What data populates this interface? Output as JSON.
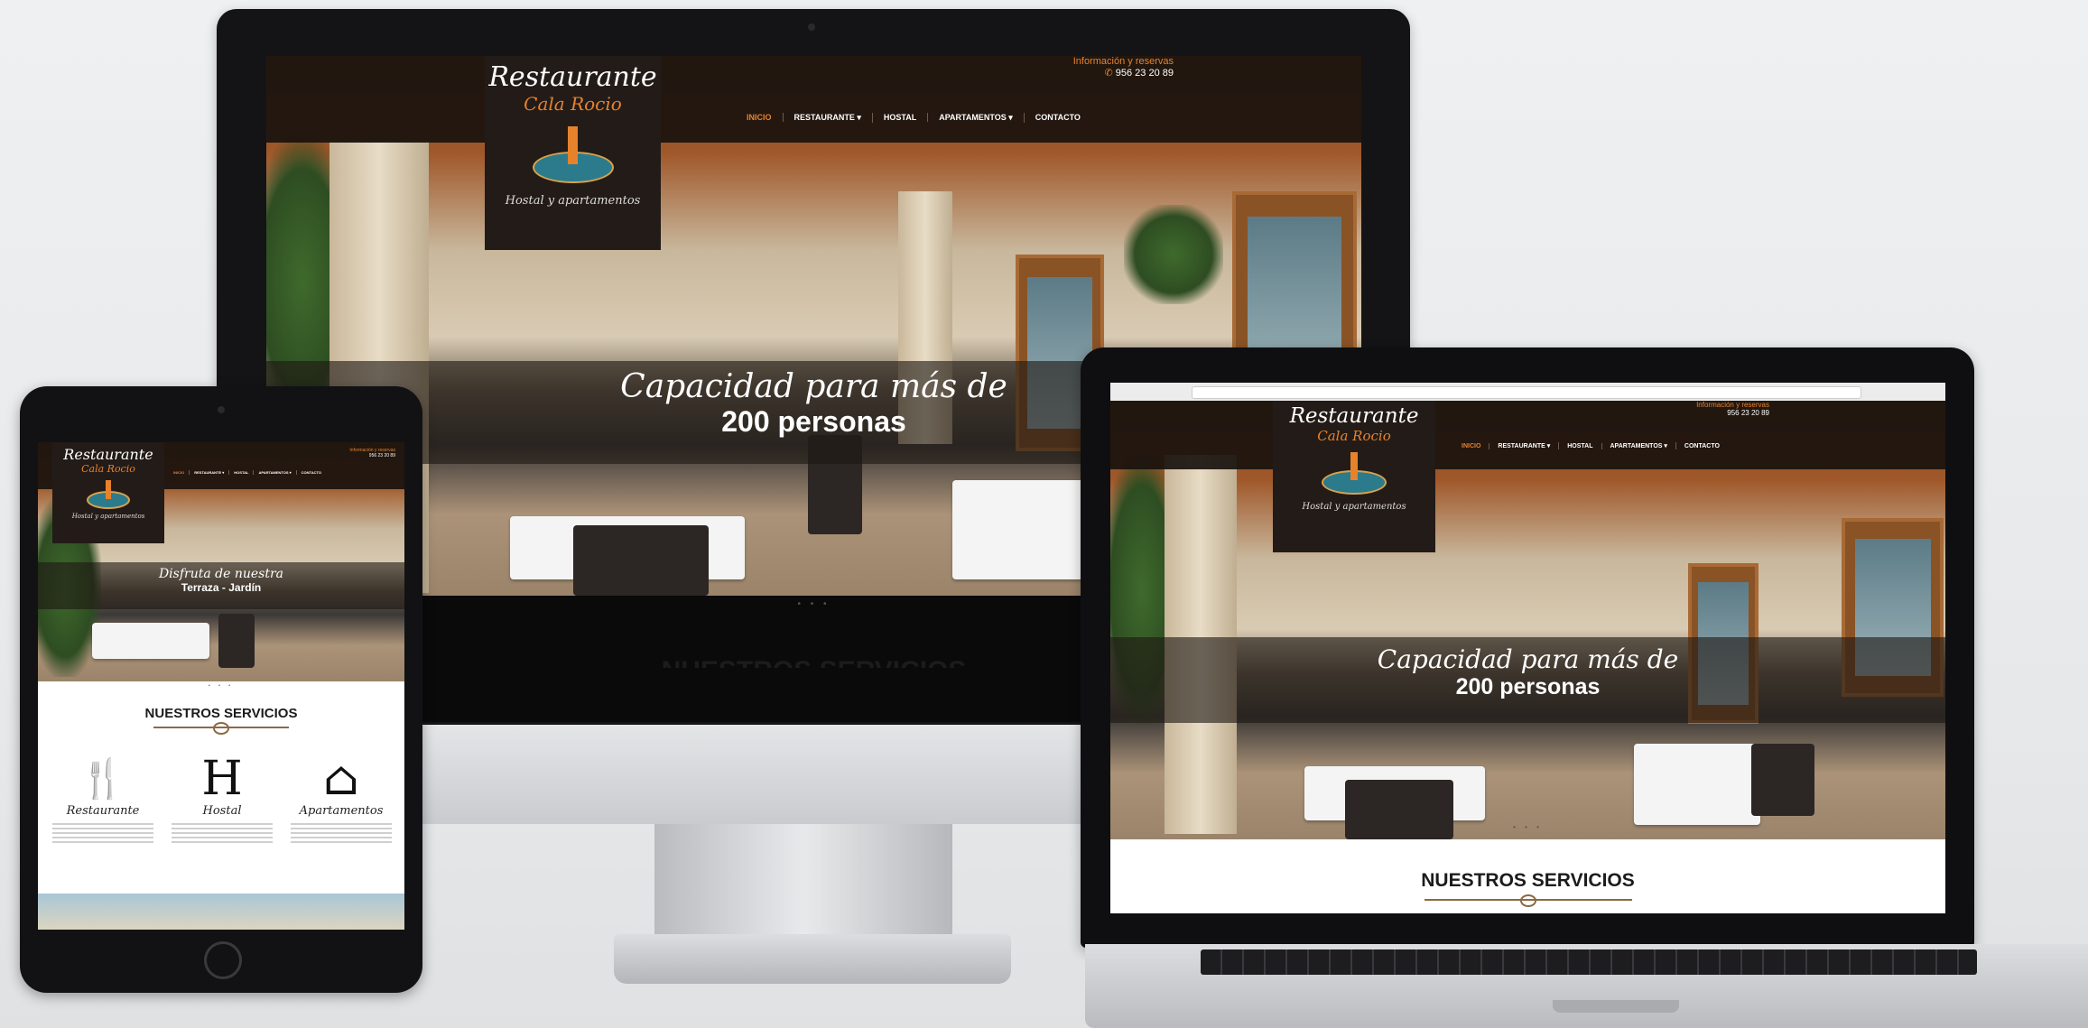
{
  "brand": {
    "title": "Restaurante",
    "subtitle": "Cala Rocio",
    "tagline": "Hostal y apartamentos"
  },
  "contact": {
    "label": "Información y reservas",
    "phone": "956 23 20 89"
  },
  "nav": {
    "items": [
      "INICIO",
      "RESTAURANTE ▾",
      "HOSTAL",
      "APARTAMENTOS ▾",
      "CONTACTO"
    ],
    "active_index": 0
  },
  "hero": {
    "caption_line1": "Capacidad para más de",
    "caption_line2": "200 personas",
    "dots": "• • •"
  },
  "tablet_hero": {
    "caption_line1": "Disfruta de nuestra",
    "caption_line2": "Terraza - Jardín"
  },
  "services": {
    "title": "NUESTROS SERVICIOS",
    "items": [
      {
        "icon": "fork-knife-icon",
        "glyph": "🍴",
        "name": "Restaurante"
      },
      {
        "icon": "hostal-h-icon",
        "glyph": "H",
        "name": "Hostal"
      },
      {
        "icon": "home-icon",
        "glyph": "⌂",
        "name": "Apartamentos"
      }
    ]
  },
  "colors": {
    "accent": "#e7822c",
    "header_bg": "#231b17"
  }
}
